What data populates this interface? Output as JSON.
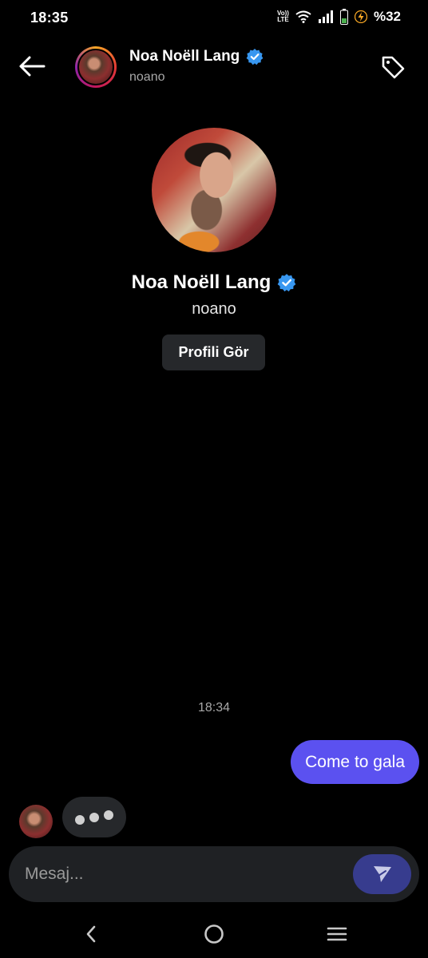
{
  "status_bar": {
    "time": "18:35",
    "volte_top": "Vo))",
    "volte_bottom": "LTE",
    "battery_percent": "%32",
    "battery_color": "#4caf50",
    "bolt_color": "#f9a825"
  },
  "header": {
    "name": "Noa Noëll Lang",
    "username": "noano",
    "verified_color": "#3897f0",
    "back_icon": "arrow-left-icon",
    "tag_icon": "tag-icon"
  },
  "profile": {
    "name": "Noa Noëll Lang",
    "username": "noano",
    "view_profile_label": "Profili Gör"
  },
  "conversation": {
    "timestamp": "18:34",
    "outgoing_message": "Come to gala",
    "outgoing_color": "#5b51f0"
  },
  "composer": {
    "placeholder": "Mesaj...",
    "send_icon": "send-icon"
  },
  "nav_bar": {
    "back_icon": "chevron-left-icon",
    "home_icon": "home-circle-icon",
    "recents_icon": "menu-icon"
  }
}
